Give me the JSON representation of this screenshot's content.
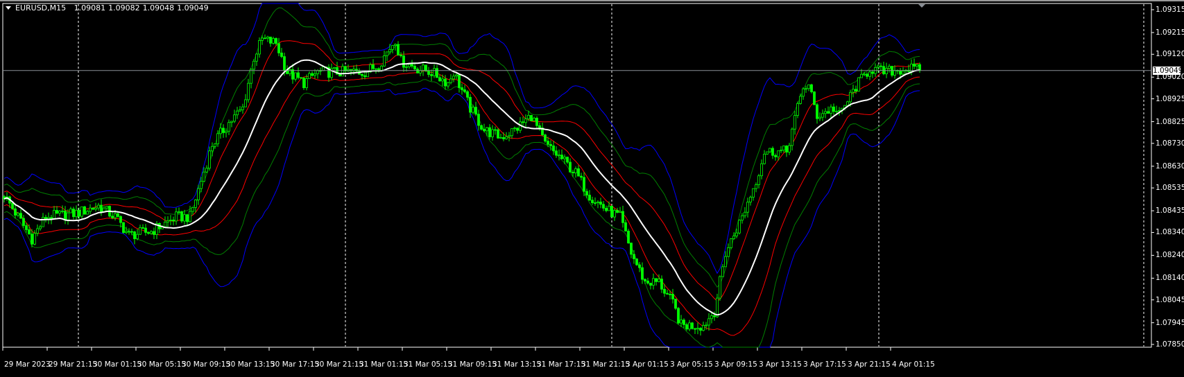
{
  "header": {
    "symbol": "EURUSD,M15",
    "open": "1.09081",
    "high": "1.09082",
    "low": "1.09048",
    "close": "1.09049"
  },
  "current_price": "1.09049",
  "price_axis": [
    "1.09315",
    "1.09215",
    "1.09120",
    "1.09020",
    "1.08925",
    "1.08825",
    "1.08730",
    "1.08630",
    "1.08535",
    "1.08435",
    "1.08340",
    "1.08240",
    "1.08140",
    "1.08045",
    "1.07945",
    "1.07850"
  ],
  "time_axis": [
    "29 Mar 2023",
    "29 Mar 21:15",
    "30 Mar 01:15",
    "30 Mar 05:15",
    "30 Mar 09:15",
    "30 Mar 13:15",
    "30 Mar 17:15",
    "30 Mar 21:15",
    "31 Mar 01:15",
    "31 Mar 05:15",
    "31 Mar 09:15",
    "31 Mar 13:15",
    "31 Mar 17:15",
    "31 Mar 21:15",
    "3 Apr 01:15",
    "3 Apr 05:15",
    "3 Apr 09:15",
    "3 Apr 13:15",
    "3 Apr 17:15",
    "3 Apr 21:15",
    "4 Apr 01:15"
  ],
  "colors": {
    "background": "#000000",
    "candles": "#00ff00",
    "moving_average": "#ffffff",
    "band_inner": "#ff0000",
    "band_middle": "#008000",
    "band_outer": "#0000ff",
    "price_line": "#8a8f96",
    "grid_separator": "#ffffff"
  },
  "chart_data": {
    "type": "candlestick",
    "timeframe": "M15",
    "ylim": [
      1.0785,
      1.09315
    ],
    "close_path": [
      [
        0,
        1.08503
      ],
      [
        10,
        1.08313
      ],
      [
        15,
        1.08408
      ],
      [
        26,
        1.08424
      ],
      [
        34,
        1.08456
      ],
      [
        40,
        1.08408
      ],
      [
        45,
        1.08329
      ],
      [
        53,
        1.08345
      ],
      [
        62,
        1.08408
      ],
      [
        67,
        1.08408
      ],
      [
        71,
        1.08567
      ],
      [
        75,
        1.08725
      ],
      [
        81,
        1.0882
      ],
      [
        86,
        1.08884
      ],
      [
        90,
        1.09106
      ],
      [
        93,
        1.09185
      ],
      [
        98,
        1.09169
      ],
      [
        102,
        1.09042
      ],
      [
        108,
        1.08995
      ],
      [
        113,
        1.09042
      ],
      [
        122,
        1.09042
      ],
      [
        130,
        1.09042
      ],
      [
        135,
        1.09074
      ],
      [
        141,
        1.09185
      ],
      [
        143,
        1.0909
      ],
      [
        149,
        1.09058
      ],
      [
        154,
        1.09042
      ],
      [
        160,
        1.08995
      ],
      [
        162,
        1.09042
      ],
      [
        168,
        1.08884
      ],
      [
        173,
        1.08789
      ],
      [
        179,
        1.08757
      ],
      [
        184,
        1.08789
      ],
      [
        190,
        1.08852
      ],
      [
        195,
        1.08725
      ],
      [
        201,
        1.08662
      ],
      [
        206,
        1.08599
      ],
      [
        211,
        1.08503
      ],
      [
        217,
        1.0844
      ],
      [
        222,
        1.08408
      ],
      [
        226,
        1.0825
      ],
      [
        231,
        1.08123
      ],
      [
        236,
        1.08123
      ],
      [
        241,
        1.08028
      ],
      [
        244,
        1.07933
      ],
      [
        252,
        1.07933
      ],
      [
        256,
        1.07996
      ],
      [
        260,
        1.0825
      ],
      [
        266,
        1.08408
      ],
      [
        271,
        1.08567
      ],
      [
        274,
        1.08694
      ],
      [
        282,
        1.08694
      ],
      [
        288,
        1.08979
      ],
      [
        290,
        1.08979
      ],
      [
        293,
        1.08852
      ],
      [
        299,
        1.08884
      ],
      [
        301,
        1.08852
      ],
      [
        307,
        1.08979
      ],
      [
        312,
        1.09058
      ],
      [
        317,
        1.09042
      ],
      [
        326,
        1.09058
      ],
      [
        330,
        1.09049
      ]
    ],
    "indicators": [
      "moving average (white)",
      "envelope band 1 (red)",
      "envelope band 2 (green)",
      "envelope band 3 (blue)"
    ],
    "separators": [
      "30 Mar",
      "31 Mar",
      "3 Apr",
      "4 Apr"
    ]
  }
}
